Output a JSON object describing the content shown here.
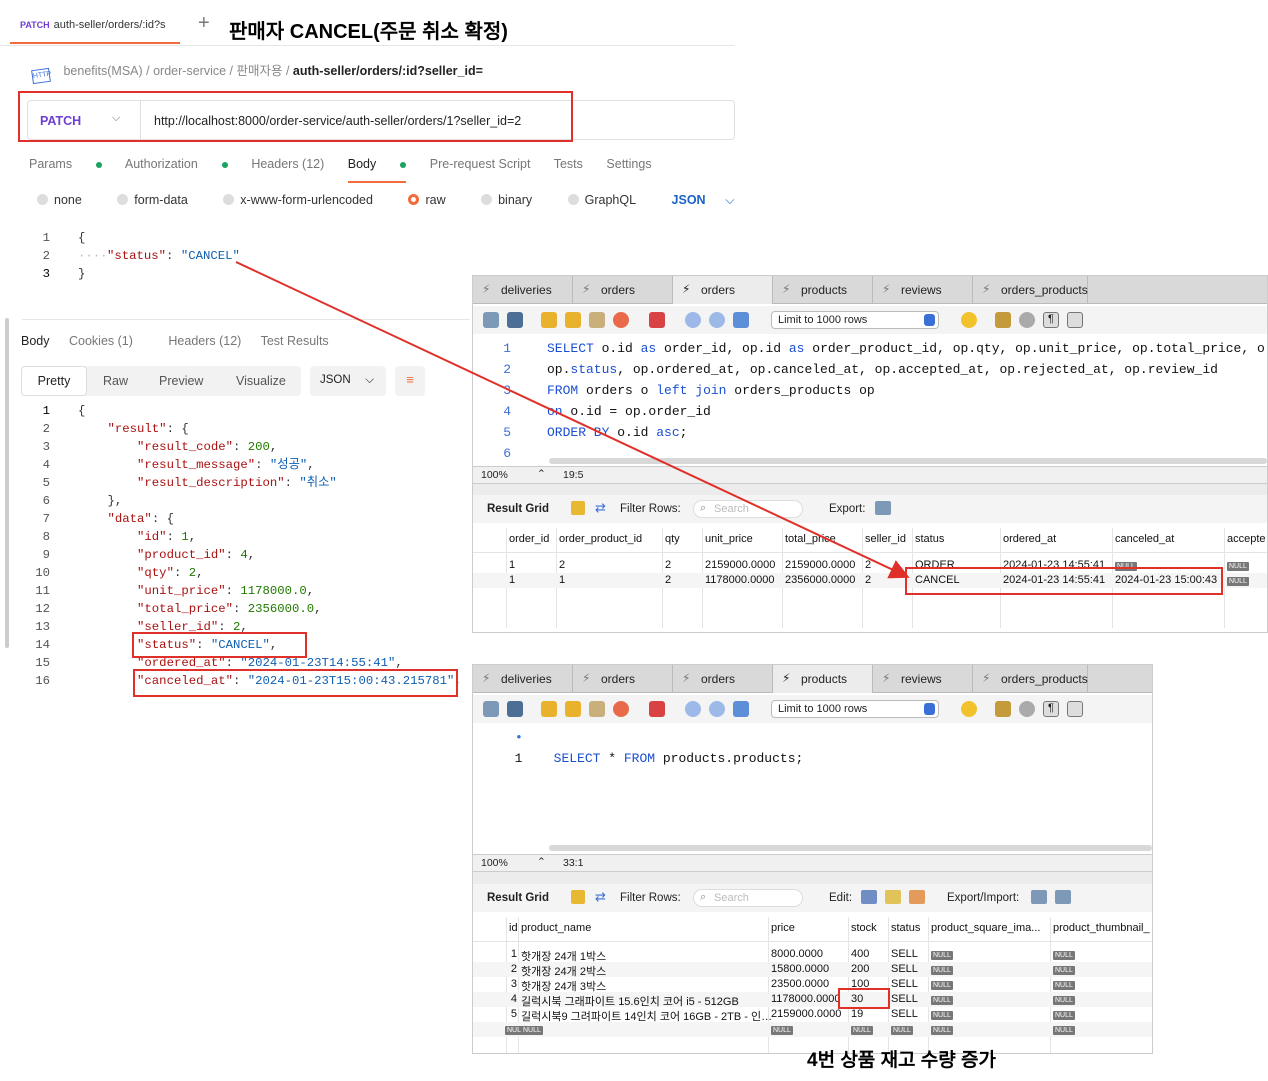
{
  "postman": {
    "tab": {
      "method": "PATCH",
      "title": "auth-seller/orders/:id?s"
    },
    "heading": "판매자 CANCEL(주문 취소 확정)",
    "breadcrumb": {
      "icon": "HTTP",
      "items": [
        "benefits(MSA)",
        "order-service",
        "판매자용"
      ],
      "current": "auth-seller/orders/:id?seller_id="
    },
    "method": "PATCH",
    "url": "http://localhost:8000/order-service/auth-seller/orders/1?seller_id=2",
    "request_tabs": [
      "Params",
      "Authorization",
      "Headers (12)",
      "Body",
      "Pre-request Script",
      "Tests",
      "Settings"
    ],
    "body_types": [
      "none",
      "form-data",
      "x-www-form-urlencoded",
      "raw",
      "binary",
      "GraphQL"
    ],
    "body_format": "JSON",
    "request_body": [
      {
        "n": "1",
        "t": "{"
      },
      {
        "n": "2",
        "k": "\"status\"",
        "s": "\"CANCEL\""
      },
      {
        "n": "3",
        "t": "}"
      }
    ],
    "response_tabs": [
      "Body",
      "Cookies (1)",
      "Headers (12)",
      "Test Results"
    ],
    "view_modes": [
      "Pretty",
      "Raw",
      "Preview",
      "Visualize"
    ],
    "view_format": "JSON",
    "response_lines": [
      [
        "1",
        "{"
      ],
      [
        "2",
        "    \"result\": {"
      ],
      [
        "3",
        "        \"result_code\": 200,"
      ],
      [
        "4",
        "        \"result_message\": \"성공\","
      ],
      [
        "5",
        "        \"result_description\": \"취소\""
      ],
      [
        "6",
        "    },"
      ],
      [
        "7",
        "    \"data\": {"
      ],
      [
        "8",
        "        \"id\": 1,"
      ],
      [
        "9",
        "        \"product_id\": 4,"
      ],
      [
        "10",
        "        \"qty\": 2,"
      ],
      [
        "11",
        "        \"unit_price\": 1178000.0,"
      ],
      [
        "12",
        "        \"total_price\": 2356000.0,"
      ],
      [
        "13",
        "        \"seller_id\": 2,"
      ],
      [
        "14",
        "        \"status\": \"CANCEL\","
      ],
      [
        "15",
        "        \"ordered_at\": \"2024-01-23T14:55:41\","
      ],
      [
        "16",
        "        \"canceled_at\": \"2024-01-23T15:00:43.215781\","
      ]
    ]
  },
  "workbench_tabs": [
    "deliveries",
    "orders",
    "orders",
    "products",
    "reviews",
    "orders_products"
  ],
  "limit_label": "Limit to 1000 rows",
  "wb1": {
    "sql": [
      [
        "1",
        "SELECT o.id as order_id, op.id as order_product_id, op.qty, op.unit_price, op.total_price, o"
      ],
      [
        "2",
        "op.status, op.ordered_at, op.canceled_at, op.accepted_at, op.rejected_at, op.review_id"
      ],
      [
        "3",
        "FROM orders o left join orders_products op"
      ],
      [
        "4",
        "on o.id = op.order_id"
      ],
      [
        "5",
        "ORDER BY o.id asc;"
      ],
      [
        "6",
        ""
      ]
    ],
    "zoom": "100%",
    "pos": "19:5",
    "result_label": "Result Grid",
    "filter_label": "Filter Rows:",
    "search_placeholder": "Search",
    "export_label": "Export:",
    "columns": [
      "order_id",
      "order_product_id",
      "qty",
      "unit_price",
      "total_price",
      "seller_id",
      "status",
      "ordered_at",
      "canceled_at",
      "accepte"
    ],
    "rows": [
      [
        "1",
        "2",
        "2",
        "2159000.0000",
        "2159000.0000",
        "2",
        "ORDER",
        "2024-01-23 14:55:41",
        "NULL",
        "NULL"
      ],
      [
        "1",
        "1",
        "2",
        "1178000.0000",
        "2356000.0000",
        "2",
        "CANCEL",
        "2024-01-23 14:55:41",
        "2024-01-23 15:00:43",
        "NULL"
      ]
    ]
  },
  "wb2": {
    "sql": [
      [
        "1",
        "SELECT * FROM products.products;"
      ]
    ],
    "zoom": "100%",
    "pos": "33:1",
    "result_label": "Result Grid",
    "filter_label": "Filter Rows:",
    "search_placeholder": "Search",
    "edit_label": "Edit:",
    "export_label": "Export/Import:",
    "columns": [
      "id",
      "product_name",
      "price",
      "stock",
      "status",
      "product_square_ima...",
      "product_thumbnail_"
    ],
    "rows": [
      [
        "1",
        "핫개장 24개 1박스",
        "8000.0000",
        "400",
        "SELL",
        "NULL",
        "NULL"
      ],
      [
        "2",
        "핫개장 24개 2박스",
        "15800.0000",
        "200",
        "SELL",
        "NULL",
        "NULL"
      ],
      [
        "3",
        "핫개장 24개 3박스",
        "23500.0000",
        "100",
        "SELL",
        "NULL",
        "NULL"
      ],
      [
        "4",
        "길럭시북 그래파이트 15.6인치 코어 i5 - 512GB",
        "1178000.0000",
        "30",
        "SELL",
        "NULL",
        "NULL"
      ],
      [
        "5",
        "길럭시북9 그려파이트 14인치 코어 16GB - 2TB - 인…",
        "2159000.0000",
        "19",
        "SELL",
        "NULL",
        "NULL"
      ],
      [
        "NULL",
        "NULL",
        "NULL",
        "NULL",
        "NULL",
        "NULL",
        "NULL"
      ]
    ]
  },
  "footer_caption": "4번 상품 재고 수량 증가",
  "colors": {
    "accent": "#f26b3a",
    "method": "#6e3fd2",
    "highlight": "#e0302a",
    "sql_keyword": "#1a4fd1"
  }
}
